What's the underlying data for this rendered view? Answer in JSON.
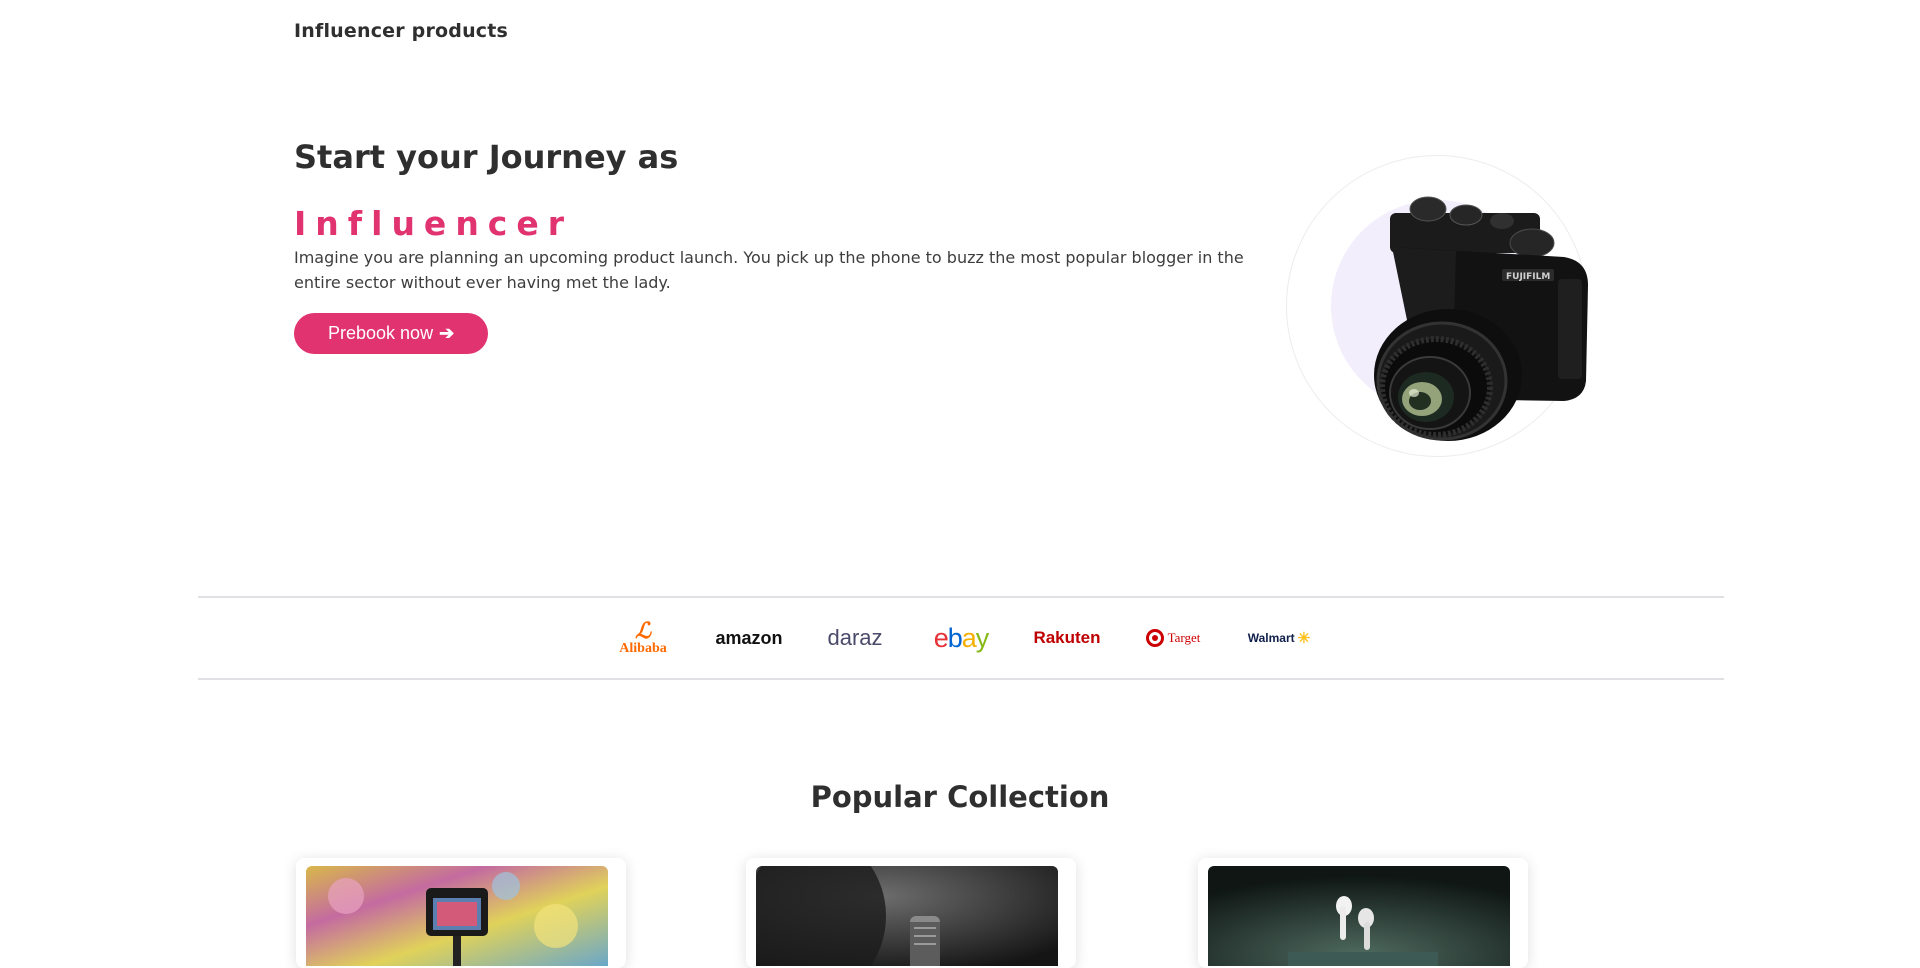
{
  "header": {
    "title": "Influencer products"
  },
  "hero": {
    "heading": "Start your Journey as",
    "accent": "Influencer",
    "description": "Imagine you are planning an upcoming product launch. You pick up the phone to buzz the most popular blogger in the entire sector without ever having met the lady.",
    "cta_label": "Prebook now",
    "cta_icon": "arrow-right-icon"
  },
  "brands": {
    "alibaba": "Alibaba",
    "amazon": "amazon",
    "daraz": "daraz",
    "ebay_e": "e",
    "ebay_b": "b",
    "ebay_a": "a",
    "ebay_y": "y",
    "rakuten": "Rakuten",
    "target": "Target",
    "walmart": "Walmart"
  },
  "collection": {
    "title": "Popular Collection",
    "cards": [
      {
        "image": "camera-on-tripod"
      },
      {
        "image": "studio-microphone"
      },
      {
        "image": "wireless-earbuds"
      }
    ]
  },
  "colors": {
    "accent": "#e0336f",
    "text": "#2f2f2f",
    "divider": "#dfe1e4"
  }
}
